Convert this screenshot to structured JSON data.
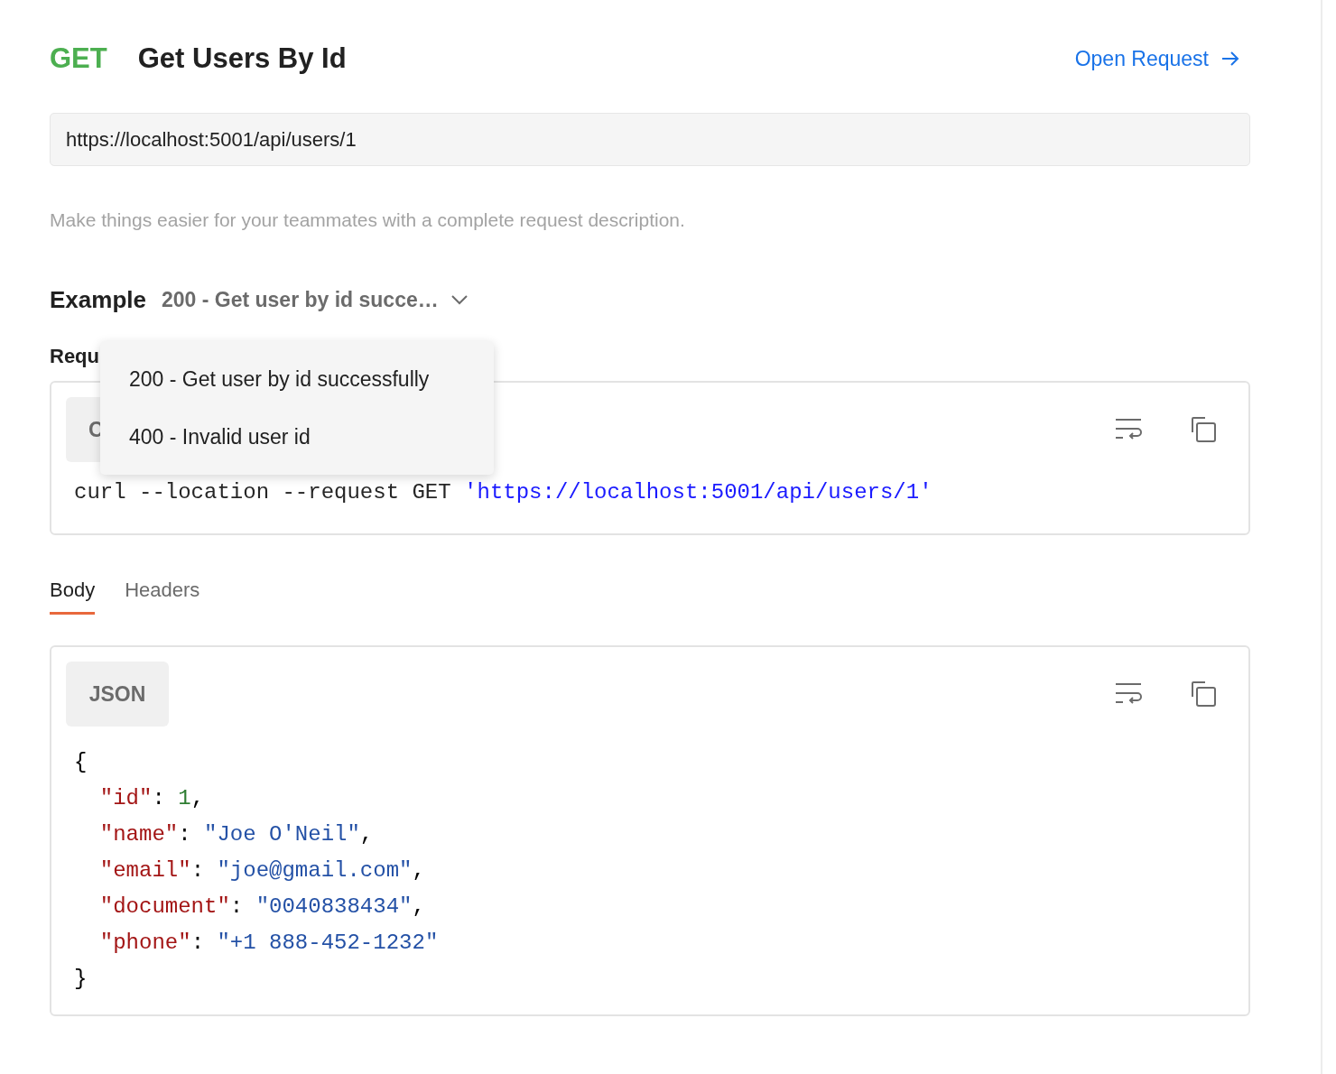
{
  "request": {
    "method": "GET",
    "name": "Get Users By Id",
    "open_link": "Open Request"
  },
  "url": {
    "value": "https://localhost:5001/api/users/1"
  },
  "description": {
    "placeholder": "Make things easier for your teammates with a complete request description."
  },
  "example": {
    "label": "Example",
    "current": "200 - Get user by id succe…",
    "menu": [
      {
        "label": "200 - Get user by id successfully"
      },
      {
        "label": "400 - Invalid user id"
      }
    ]
  },
  "request_snippet": {
    "label": "Requ",
    "language": "C",
    "lines": [
      [
        {
          "kind": "plain",
          "text": "curl --location --request GET "
        },
        {
          "kind": "url",
          "text": "'https://localhost:5001/api/users/1'"
        }
      ]
    ]
  },
  "tabs": [
    {
      "label": "Body",
      "selected": true
    },
    {
      "label": "Headers",
      "selected": false
    }
  ],
  "response": {
    "language": "JSON",
    "lines": [
      [
        {
          "kind": "punct",
          "text": "{"
        }
      ],
      {
        "children": [
          [
            {
              "kind": "key",
              "text": "\"id\""
            },
            {
              "kind": "punct",
              "text": ": "
            },
            {
              "kind": "number",
              "text": "1"
            },
            {
              "kind": "punct",
              "text": ","
            }
          ],
          [
            {
              "kind": "key",
              "text": "\"name\""
            },
            {
              "kind": "punct",
              "text": ": "
            },
            {
              "kind": "string",
              "text": "\"Joe O'Neil\""
            },
            {
              "kind": "punct",
              "text": ","
            }
          ],
          [
            {
              "kind": "key",
              "text": "\"email\""
            },
            {
              "kind": "punct",
              "text": ": "
            },
            {
              "kind": "string",
              "text": "\"joe@gmail.com\""
            },
            {
              "kind": "punct",
              "text": ","
            }
          ],
          [
            {
              "kind": "key",
              "text": "\"document\""
            },
            {
              "kind": "punct",
              "text": ": "
            },
            {
              "kind": "string",
              "text": "\"0040838434\""
            },
            {
              "kind": "punct",
              "text": ","
            }
          ],
          [
            {
              "kind": "key",
              "text": "\"phone\""
            },
            {
              "kind": "punct",
              "text": ": "
            },
            {
              "kind": "string",
              "text": "\"+1 888-452-1232\""
            }
          ]
        ]
      },
      [
        {
          "kind": "punct",
          "text": "}"
        }
      ]
    ]
  }
}
